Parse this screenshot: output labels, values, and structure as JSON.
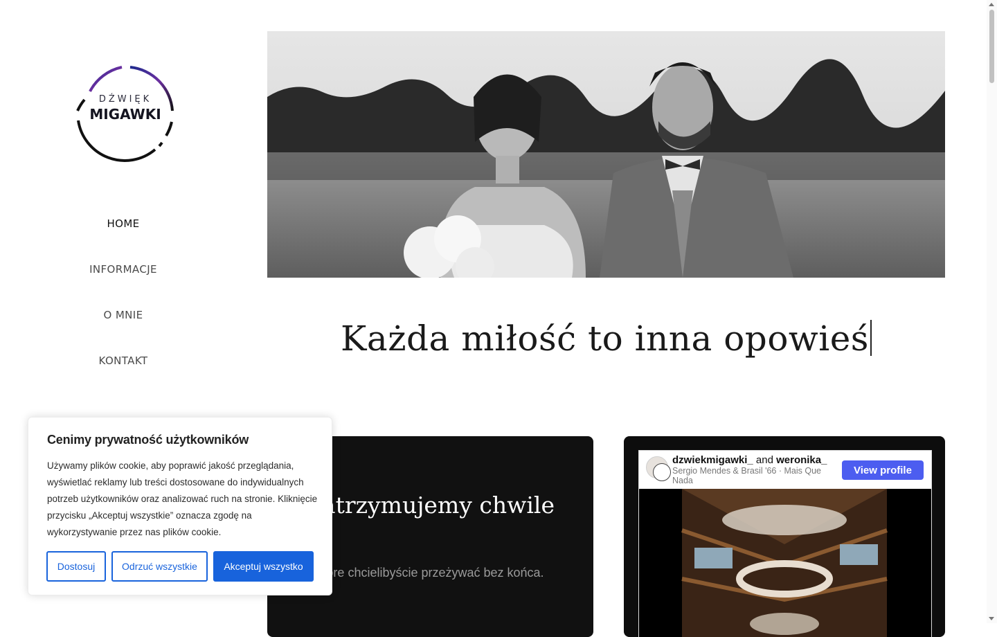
{
  "logo": {
    "top_text": "DŹWIĘK",
    "main_text": "MIGAWKI"
  },
  "nav": {
    "items": [
      {
        "label": "HOME"
      },
      {
        "label": "INFORMACJE"
      },
      {
        "label": "O MNIE"
      },
      {
        "label": "KONTAKT"
      }
    ]
  },
  "hero": {
    "image": "wedding-couple-bw-photo"
  },
  "headline": {
    "text": "Każda miłość to inna opowieś"
  },
  "card": {
    "title": "Zatrzymujemy chwile",
    "subtitle": "które chcielibyście przeżywać bez końca."
  },
  "instagram": {
    "user1": "dzwiekmigawki_",
    "joiner": "and",
    "user2": "weronika_",
    "song": "Sergio Mendes & Brasil '66 · Mais Que Nada",
    "button": "View profile"
  },
  "cookie": {
    "title": "Cenimy prywatność użytkowników",
    "body": "Używamy plików cookie, aby poprawić jakość przeglądania, wyświetlać reklamy lub treści dostosowane do indywidualnych potrzeb użytkowników oraz analizować ruch na stronie. Kliknięcie przycisku „Akceptuj wszystkie” oznacza zgodę na wykorzystywanie przez nas plików cookie.",
    "btn_customize": "Dostosuj",
    "btn_reject": "Odrzuć wszystkie",
    "btn_accept": "Akceptuj wszystko"
  },
  "colors": {
    "accent": "#1863dc",
    "instagram_button": "#4c5df0",
    "dark_card": "#111111"
  }
}
